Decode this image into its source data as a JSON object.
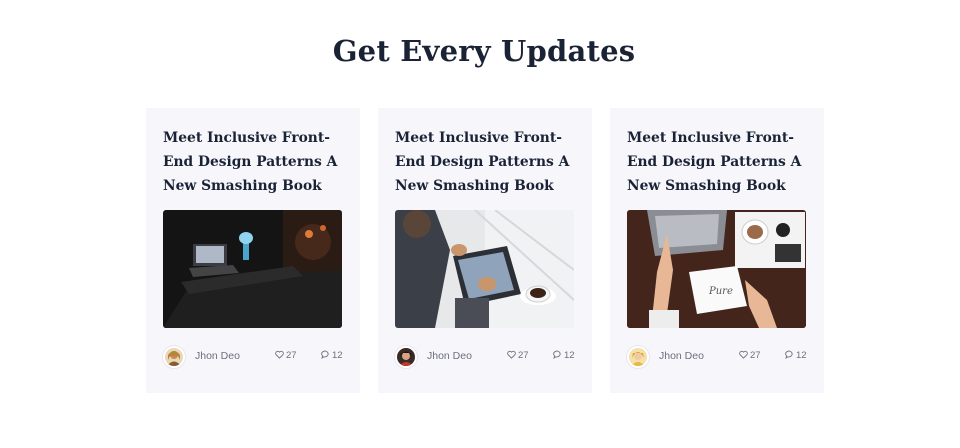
{
  "section": {
    "title": "Get Every Updates"
  },
  "cards": [
    {
      "title": "Meet Inclusive Front-End Design Patterns A New Smashing Book",
      "author": "Jhon Deo",
      "likes": "27",
      "comments": "12",
      "image": "laptop-desk-night-photo",
      "avatar": "author-avatar-1"
    },
    {
      "title": "Meet Inclusive Front-End Design Patterns A New Smashing Book",
      "author": "Jhon Deo",
      "likes": "27",
      "comments": "12",
      "image": "tablet-coffee-photo",
      "avatar": "author-avatar-2"
    },
    {
      "title": "Meet Inclusive Front-End Design Patterns A New Smashing Book",
      "author": "Jhon Deo",
      "likes": "27",
      "comments": "12",
      "image": "workspace-top-view-photo",
      "avatar": "author-avatar-3"
    }
  ],
  "icons": {
    "likes": "heart-icon",
    "comments": "comment-icon"
  },
  "colors": {
    "heading": "#1a2236",
    "card_bg": "#f6f6fb",
    "meta_text": "#6c6f7d"
  }
}
